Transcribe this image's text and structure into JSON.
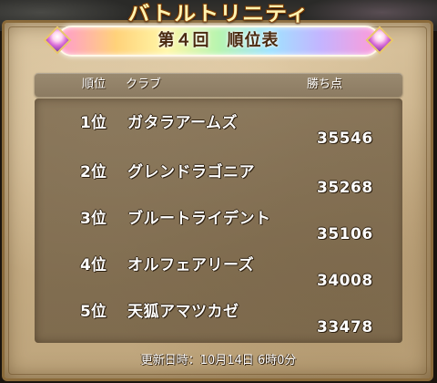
{
  "event_title": "バトルトリニティ",
  "ranking_title": "第４回　順位表",
  "columns": {
    "rank": "順位",
    "club": "クラブ",
    "points": "勝ち点"
  },
  "rows": [
    {
      "rank": "1位",
      "club": "ガタラアームズ",
      "points": "35546"
    },
    {
      "rank": "2位",
      "club": "グレンドラゴニア",
      "points": "35268"
    },
    {
      "rank": "3位",
      "club": "ブルートライデント",
      "points": "35106"
    },
    {
      "rank": "4位",
      "club": "オルフェアリーズ",
      "points": "34008"
    },
    {
      "rank": "5位",
      "club": "天狐アマツカゼ",
      "points": "33478"
    }
  ],
  "updated": {
    "label": "更新日時：",
    "value": "10月14日 6時0分"
  },
  "colors": {
    "text": "#ffffff",
    "header_bar": "#8c7b62",
    "panel": "#6e5c42",
    "parchment": "#c9b088",
    "title_gold": "#fff3b0"
  }
}
